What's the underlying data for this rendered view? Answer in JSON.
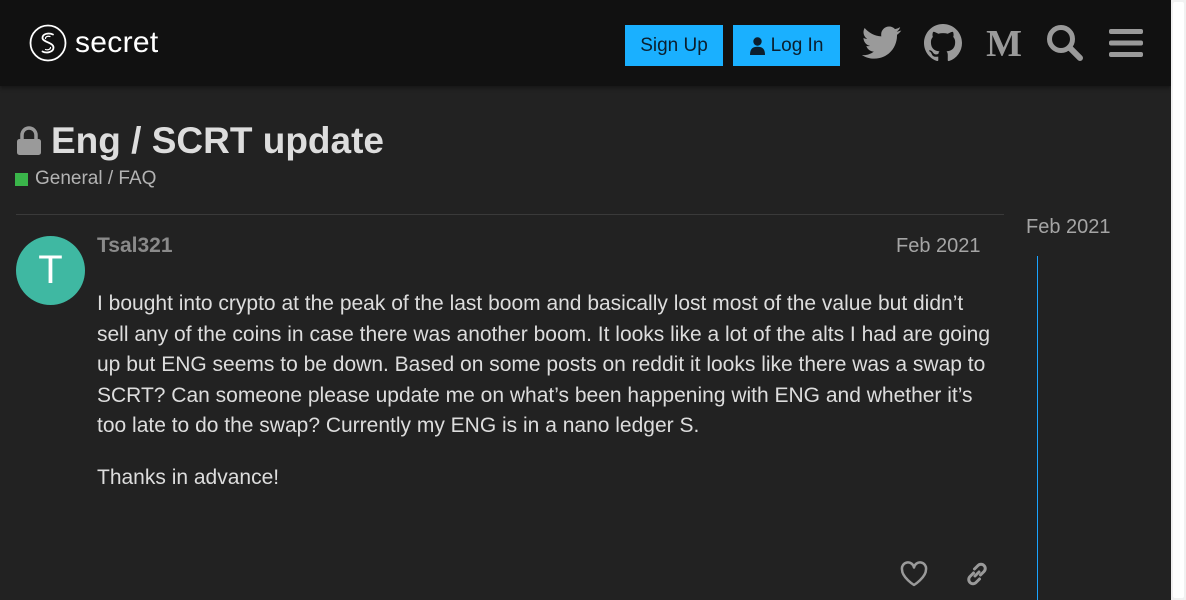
{
  "header": {
    "logo_text": "secret",
    "signup_label": "Sign Up",
    "login_label": "Log In",
    "icons": [
      "twitter-icon",
      "github-icon",
      "medium-icon",
      "search-icon",
      "hamburger-menu-icon"
    ]
  },
  "topic": {
    "title": "Eng / SCRT update",
    "category": "General / FAQ",
    "category_color": "#3ab54a"
  },
  "post": {
    "avatar_letter": "T",
    "avatar_color": "#3fb8a2",
    "username": "Tsal321",
    "date": "Feb 2021",
    "paragraphs": [
      "I bought into crypto at the peak of the last boom and basically lost most of the value but didn’t sell any of the coins in case there was another boom. It looks like a lot of the alts I had are going up but ENG seems to be down. Based on some posts on reddit it looks like there was a swap to SCRT? Can someone please update me on what’s been happening with ENG and whether it’s too late to do the swap? Currently my ENG is in a nano ledger S.",
      "Thanks in advance!"
    ]
  },
  "timeline": {
    "date": "Feb 2021"
  },
  "colors": {
    "accent": "#1ab0ff",
    "background": "#222222",
    "header": "#111111"
  }
}
